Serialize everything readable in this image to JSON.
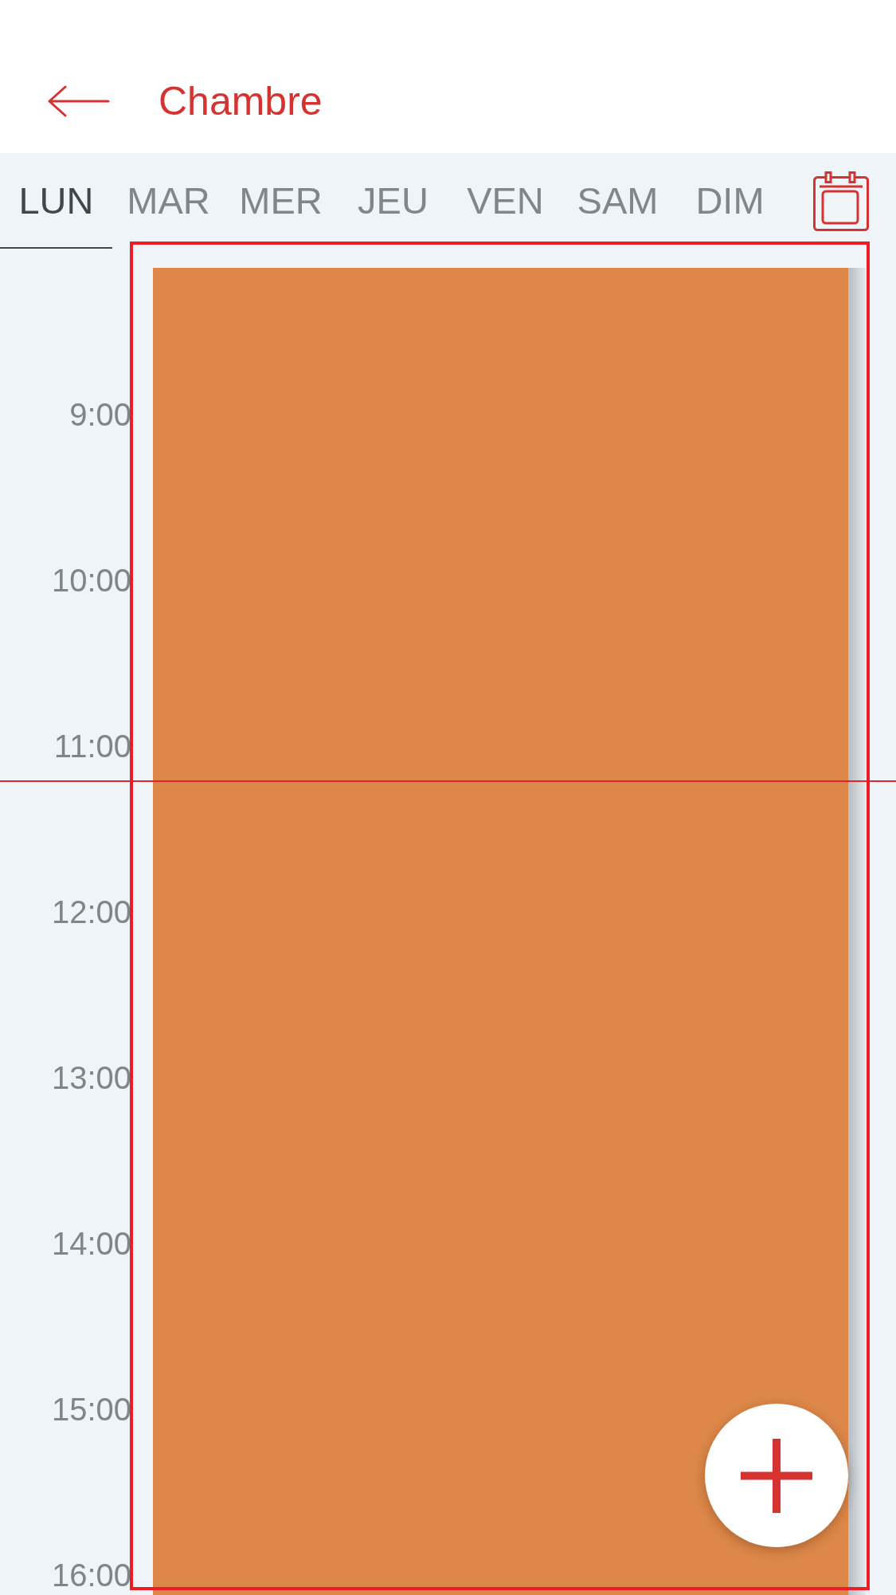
{
  "header": {
    "title": "Chambre"
  },
  "days": [
    {
      "label": "LUN",
      "selected": true
    },
    {
      "label": "MAR",
      "selected": false
    },
    {
      "label": "MER",
      "selected": false
    },
    {
      "label": "JEU",
      "selected": false
    },
    {
      "label": "VEN",
      "selected": false
    },
    {
      "label": "SAM",
      "selected": false
    },
    {
      "label": "DIM",
      "selected": false
    }
  ],
  "hours": [
    "9:00",
    "10:00",
    "11:00",
    "12:00",
    "13:00",
    "14:00",
    "15:00",
    "16:00"
  ],
  "events": [
    {
      "color": "#dd8749"
    }
  ]
}
